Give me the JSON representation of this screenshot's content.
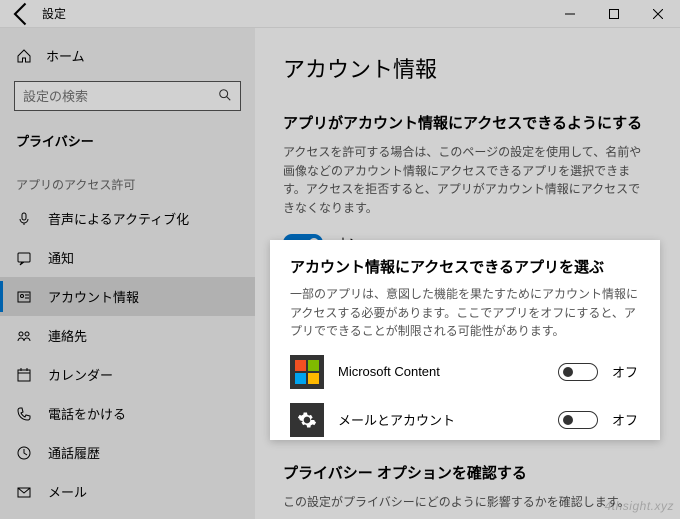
{
  "titlebar": {
    "title": "設定"
  },
  "sidebar": {
    "home": "ホーム",
    "search_placeholder": "設定の検索",
    "category": "プライバシー",
    "section_label": "アプリのアクセス許可",
    "items": [
      {
        "label": "音声によるアクティブ化"
      },
      {
        "label": "通知"
      },
      {
        "label": "アカウント情報"
      },
      {
        "label": "連絡先"
      },
      {
        "label": "カレンダー"
      },
      {
        "label": "電話をかける"
      },
      {
        "label": "通話履歴"
      },
      {
        "label": "メール"
      }
    ]
  },
  "main": {
    "heading": "アカウント情報",
    "section1_title": "アプリがアカウント情報にアクセスできるようにする",
    "section1_desc": "アクセスを許可する場合は、このページの設定を使用して、名前や画像などのアカウント情報にアクセスできるアプリを選択できます。アクセスを拒否すると、アプリがアカウント情報にアクセスできなくなります。",
    "master_toggle_state": "オン",
    "section2_title": "アカウント情報にアクセスできるアプリを選ぶ",
    "section2_desc": "一部のアプリは、意図した機能を果たすためにアカウント情報にアクセスする必要があります。ここでアプリをオフにすると、アプリでできることが制限される可能性があります。",
    "apps": [
      {
        "name": "Microsoft Content",
        "state": "オフ"
      },
      {
        "name": "メールとアカウント",
        "state": "オフ"
      }
    ],
    "section3_title": "プライバシー オプションを確認する",
    "section3_desc": "この設定がプライバシーにどのように影響するかを確認します。"
  },
  "watermark": "4thsight.xyz"
}
